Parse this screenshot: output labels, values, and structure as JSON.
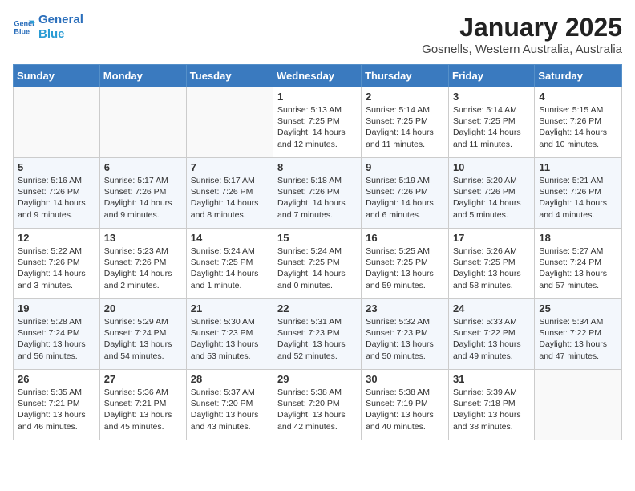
{
  "header": {
    "logo_line1": "General",
    "logo_line2": "Blue",
    "month_title": "January 2025",
    "location": "Gosnells, Western Australia, Australia"
  },
  "weekdays": [
    "Sunday",
    "Monday",
    "Tuesday",
    "Wednesday",
    "Thursday",
    "Friday",
    "Saturday"
  ],
  "weeks": [
    [
      {
        "day": "",
        "info": ""
      },
      {
        "day": "",
        "info": ""
      },
      {
        "day": "",
        "info": ""
      },
      {
        "day": "1",
        "info": "Sunrise: 5:13 AM\nSunset: 7:25 PM\nDaylight: 14 hours\nand 12 minutes."
      },
      {
        "day": "2",
        "info": "Sunrise: 5:14 AM\nSunset: 7:25 PM\nDaylight: 14 hours\nand 11 minutes."
      },
      {
        "day": "3",
        "info": "Sunrise: 5:14 AM\nSunset: 7:25 PM\nDaylight: 14 hours\nand 11 minutes."
      },
      {
        "day": "4",
        "info": "Sunrise: 5:15 AM\nSunset: 7:26 PM\nDaylight: 14 hours\nand 10 minutes."
      }
    ],
    [
      {
        "day": "5",
        "info": "Sunrise: 5:16 AM\nSunset: 7:26 PM\nDaylight: 14 hours\nand 9 minutes."
      },
      {
        "day": "6",
        "info": "Sunrise: 5:17 AM\nSunset: 7:26 PM\nDaylight: 14 hours\nand 9 minutes."
      },
      {
        "day": "7",
        "info": "Sunrise: 5:17 AM\nSunset: 7:26 PM\nDaylight: 14 hours\nand 8 minutes."
      },
      {
        "day": "8",
        "info": "Sunrise: 5:18 AM\nSunset: 7:26 PM\nDaylight: 14 hours\nand 7 minutes."
      },
      {
        "day": "9",
        "info": "Sunrise: 5:19 AM\nSunset: 7:26 PM\nDaylight: 14 hours\nand 6 minutes."
      },
      {
        "day": "10",
        "info": "Sunrise: 5:20 AM\nSunset: 7:26 PM\nDaylight: 14 hours\nand 5 minutes."
      },
      {
        "day": "11",
        "info": "Sunrise: 5:21 AM\nSunset: 7:26 PM\nDaylight: 14 hours\nand 4 minutes."
      }
    ],
    [
      {
        "day": "12",
        "info": "Sunrise: 5:22 AM\nSunset: 7:26 PM\nDaylight: 14 hours\nand 3 minutes."
      },
      {
        "day": "13",
        "info": "Sunrise: 5:23 AM\nSunset: 7:26 PM\nDaylight: 14 hours\nand 2 minutes."
      },
      {
        "day": "14",
        "info": "Sunrise: 5:24 AM\nSunset: 7:25 PM\nDaylight: 14 hours\nand 1 minute."
      },
      {
        "day": "15",
        "info": "Sunrise: 5:24 AM\nSunset: 7:25 PM\nDaylight: 14 hours\nand 0 minutes."
      },
      {
        "day": "16",
        "info": "Sunrise: 5:25 AM\nSunset: 7:25 PM\nDaylight: 13 hours\nand 59 minutes."
      },
      {
        "day": "17",
        "info": "Sunrise: 5:26 AM\nSunset: 7:25 PM\nDaylight: 13 hours\nand 58 minutes."
      },
      {
        "day": "18",
        "info": "Sunrise: 5:27 AM\nSunset: 7:24 PM\nDaylight: 13 hours\nand 57 minutes."
      }
    ],
    [
      {
        "day": "19",
        "info": "Sunrise: 5:28 AM\nSunset: 7:24 PM\nDaylight: 13 hours\nand 56 minutes."
      },
      {
        "day": "20",
        "info": "Sunrise: 5:29 AM\nSunset: 7:24 PM\nDaylight: 13 hours\nand 54 minutes."
      },
      {
        "day": "21",
        "info": "Sunrise: 5:30 AM\nSunset: 7:23 PM\nDaylight: 13 hours\nand 53 minutes."
      },
      {
        "day": "22",
        "info": "Sunrise: 5:31 AM\nSunset: 7:23 PM\nDaylight: 13 hours\nand 52 minutes."
      },
      {
        "day": "23",
        "info": "Sunrise: 5:32 AM\nSunset: 7:23 PM\nDaylight: 13 hours\nand 50 minutes."
      },
      {
        "day": "24",
        "info": "Sunrise: 5:33 AM\nSunset: 7:22 PM\nDaylight: 13 hours\nand 49 minutes."
      },
      {
        "day": "25",
        "info": "Sunrise: 5:34 AM\nSunset: 7:22 PM\nDaylight: 13 hours\nand 47 minutes."
      }
    ],
    [
      {
        "day": "26",
        "info": "Sunrise: 5:35 AM\nSunset: 7:21 PM\nDaylight: 13 hours\nand 46 minutes."
      },
      {
        "day": "27",
        "info": "Sunrise: 5:36 AM\nSunset: 7:21 PM\nDaylight: 13 hours\nand 45 minutes."
      },
      {
        "day": "28",
        "info": "Sunrise: 5:37 AM\nSunset: 7:20 PM\nDaylight: 13 hours\nand 43 minutes."
      },
      {
        "day": "29",
        "info": "Sunrise: 5:38 AM\nSunset: 7:20 PM\nDaylight: 13 hours\nand 42 minutes."
      },
      {
        "day": "30",
        "info": "Sunrise: 5:38 AM\nSunset: 7:19 PM\nDaylight: 13 hours\nand 40 minutes."
      },
      {
        "day": "31",
        "info": "Sunrise: 5:39 AM\nSunset: 7:18 PM\nDaylight: 13 hours\nand 38 minutes."
      },
      {
        "day": "",
        "info": ""
      }
    ]
  ]
}
